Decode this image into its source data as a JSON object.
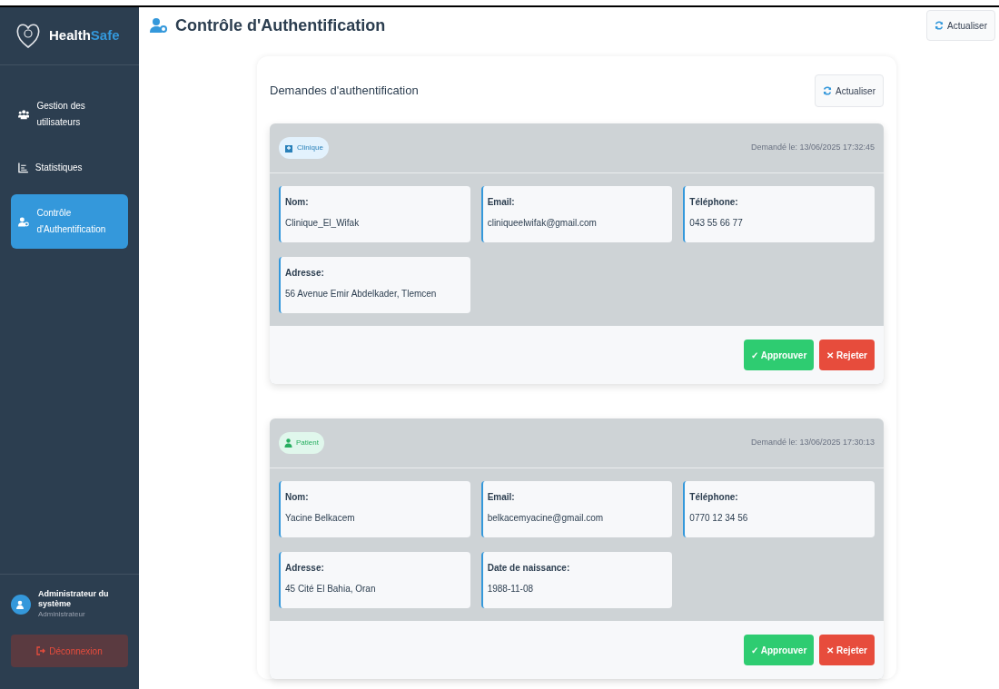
{
  "sidebar": {
    "brand": {
      "part1": "Health",
      "part2": "Safe"
    },
    "items": [
      {
        "label": "Gestion des utilisateurs",
        "kind": "users",
        "selected": false
      },
      {
        "label": "Statistiques",
        "kind": "chart",
        "selected": false
      },
      {
        "label": "Contrôle d'Authentification",
        "kind": "user-shield",
        "selected": true
      }
    ],
    "user": {
      "name": "Administrateur du système",
      "role": "Administrateur"
    },
    "logout": "Déconnexion"
  },
  "header": {
    "title": "Contrôle d'Authentification",
    "refresh": "Actualiser"
  },
  "panel": {
    "title": "Demandes d'authentification",
    "refresh": "Actualiser",
    "requests": [
      {
        "kind": "clinique",
        "badge": "Clinique",
        "date": "Demandé le: 13/06/2025 17:32:45",
        "fields": [
          {
            "label": "Nom:",
            "value": "Clinique_El_Wifak"
          },
          {
            "label": "Email:",
            "value": "cliniqueelwifak@gmail.com"
          },
          {
            "label": "Téléphone:",
            "value": "043 55 66 77"
          },
          {
            "label": "Adresse:",
            "value": "56 Avenue Emir Abdelkader, Tlemcen"
          }
        ],
        "approve": "✓ Approuver",
        "reject": "✕ Rejeter"
      },
      {
        "kind": "patient",
        "badge": "Patient",
        "date": "Demandé le: 13/06/2025 17:30:13",
        "fields": [
          {
            "label": "Nom:",
            "value": "Yacine Belkacem"
          },
          {
            "label": "Email:",
            "value": "belkacemyacine@gmail.com"
          },
          {
            "label": "Téléphone:",
            "value": "0770 12 34 56"
          },
          {
            "label": "Adresse:",
            "value": "45 Cité El Bahia, Oran"
          },
          {
            "label": "Date de naissance:",
            "value": "1988-11-08"
          }
        ],
        "approve": "✓ Approuver",
        "reject": "✕ Rejeter"
      }
    ]
  }
}
